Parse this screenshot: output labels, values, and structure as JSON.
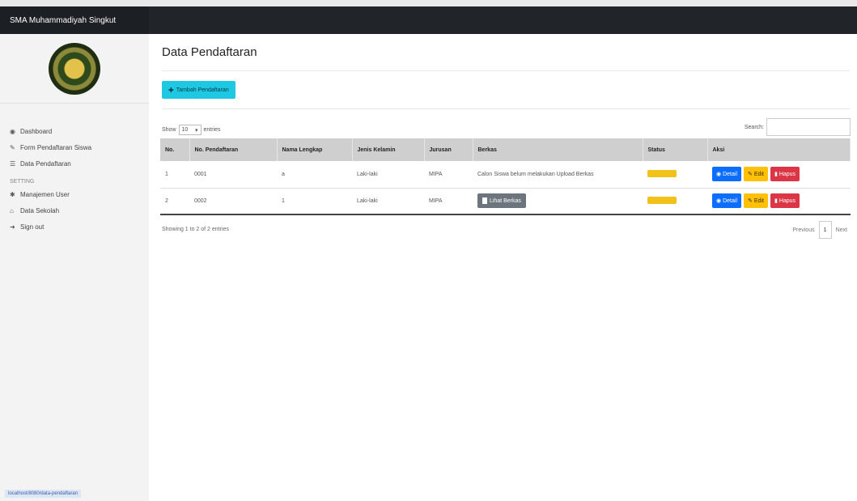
{
  "topbar": {
    "brand": "SMA Muhammadiyah Singkut"
  },
  "sidebar": {
    "items": [
      {
        "icon": "dashboard-icon",
        "glyph": "◉",
        "label": "Dashboard"
      },
      {
        "icon": "edit-form-icon",
        "glyph": "✎",
        "label": "Form Pendaftaran Siswa"
      },
      {
        "icon": "list-icon",
        "glyph": "☰",
        "label": "Data Pendaftaran"
      }
    ],
    "heading": "SETTING",
    "settings": [
      {
        "icon": "users-icon",
        "glyph": "✱",
        "label": "Manajemen User"
      },
      {
        "icon": "home-icon",
        "glyph": "⌂",
        "label": "Data Sekolah"
      },
      {
        "icon": "sign-out-icon",
        "glyph": "➜",
        "label": "Sign out"
      }
    ],
    "status_url": "localhost/8080/data-pendaftaran"
  },
  "main": {
    "title": "Data Pendaftaran",
    "add_button": "Tambah Pendaftaran",
    "show_label": "Show",
    "entries_value": "10",
    "entries_label": "entries",
    "search_label": "Search:",
    "columns": [
      "No.",
      "No. Pendaftaran",
      "Nama Lengkap",
      "Jenis Kelamin",
      "Jurusan",
      "Berkas",
      "Status",
      "Aksi"
    ],
    "rows": [
      {
        "no": "1",
        "no_pendaftaran": "0001",
        "nama": "a",
        "jk": "Laki-laki",
        "jurusan": "MIPA",
        "berkas": "Calon Siswa belum melakukan Upload Berkas"
      },
      {
        "no": "2",
        "no_pendaftaran": "0002",
        "nama": "1",
        "jk": "Laki-laki",
        "jurusan": "MIPA",
        "berkas_button": "Lihat Berkas"
      }
    ],
    "btn_detail": "Detail",
    "btn_edit": "Edit",
    "btn_hapus": "Hapus",
    "showing": "Showing 1 to 2 of 2 entries",
    "prev": "Previous",
    "page": "1",
    "next": "Next"
  },
  "colors": {
    "topbar": "#212529",
    "info": "#1ec8e3",
    "primary": "#0d6efd",
    "warning": "#ffc107",
    "danger": "#dc3545",
    "secondary": "#6c757d"
  }
}
